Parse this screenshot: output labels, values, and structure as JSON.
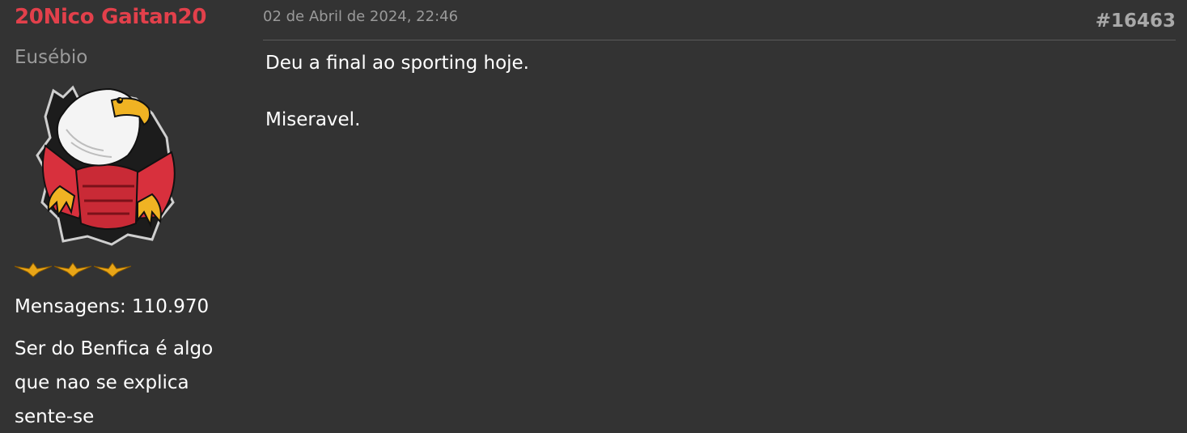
{
  "author": {
    "username": "20Nico Gaitan20",
    "rank_title": "Eusébio",
    "avatar": "benfica-eagle-avatar",
    "rank_badges": [
      "gold-eagle-badge",
      "gold-eagle-badge",
      "gold-eagle-badge"
    ],
    "message_count": "Mensagens: 110.970",
    "signature_lines": [
      "Ser do Benfica é algo",
      "que nao se explica",
      "sente-se"
    ]
  },
  "post": {
    "timestamp": "02 de Abril de 2024, 22:46",
    "number": "#16463",
    "paragraphs": [
      "Deu a final ao sporting hoje.",
      "Miseravel."
    ]
  },
  "colors": {
    "background": "#333333",
    "username": "#e2404b",
    "muted": "#9b9b9b",
    "text": "#ffffff",
    "badge_gold": "#e8a517"
  }
}
